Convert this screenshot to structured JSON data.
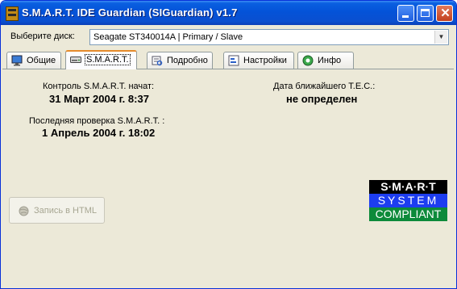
{
  "window": {
    "title": "S.M.A.R.T. IDE Guardian (SIGuardian) v1.7",
    "close_glyph": "✕"
  },
  "disk": {
    "label": "Выберите диск:",
    "selected": "Seagate ST340014A  |  Primary / Slave"
  },
  "tabs": [
    {
      "label": "Общие",
      "icon": "monitor-icon"
    },
    {
      "label": "S.M.A.R.T.",
      "icon": "hard-drive-icon",
      "active": true
    },
    {
      "label": "Подробно",
      "icon": "details-icon"
    },
    {
      "label": "Настройки",
      "icon": "settings-icon"
    },
    {
      "label": "Инфо",
      "icon": "info-icon"
    }
  ],
  "smart": {
    "started_label": "Контроль S.M.A.R.T. начат:",
    "started_value": "31 Март 2004 г. 8:37",
    "last_check_label": "Последняя проверка S.M.A.R.T. :",
    "last_check_value": "1 Апрель 2004 г. 18:02",
    "tec_label": "Дата ближайшего T.E.C.:",
    "tec_value": "не определен"
  },
  "html_button": {
    "label": "Запись в HTML",
    "enabled": false
  },
  "logo": {
    "line1": "S·M·A·R·T",
    "line2": "SYSTEM",
    "line3": "COMPLIANT"
  },
  "colors": {
    "titlebar": "#0453d8",
    "logo_blue": "#1d3df0",
    "logo_green": "#0d8a3a",
    "active_tab_accent": "#e68b2c"
  }
}
